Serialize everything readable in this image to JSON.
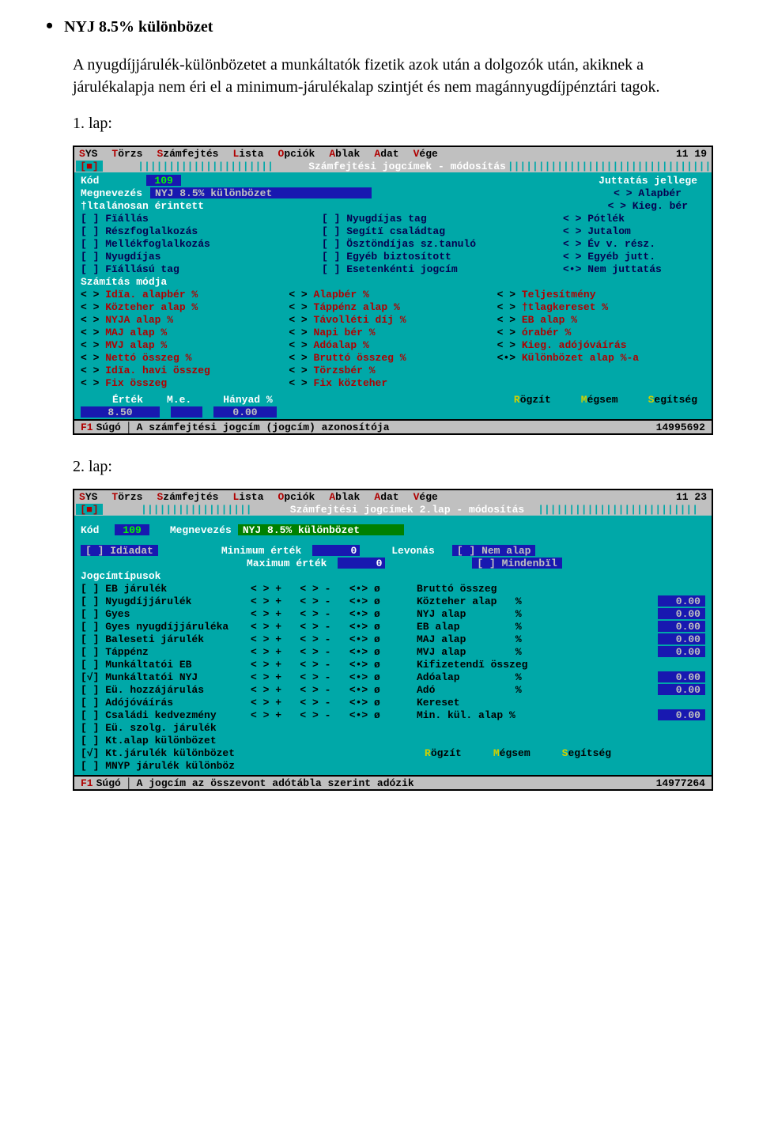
{
  "doc": {
    "heading": "NYJ 8.5% különbözet",
    "paragraph": "A nyugdíjjárulék-különbözetet a munkáltatók fizetik azok után a dolgozók után, akiknek a járulékalapja nem éri el a minimum-járulékalap szintjét és nem magánnyugdíjpénztári tagok.",
    "lap1": "1. lap:",
    "lap2": "2. lap:"
  },
  "win1": {
    "menu": [
      "SYS",
      "Törzs",
      "Számfejtés",
      "Lista",
      "Opciók",
      "Ablak",
      "Adat",
      "Vége"
    ],
    "time": "11 19",
    "title": "Számfejtési jogcímek - módosítás",
    "kod_lbl": "Kód",
    "kod_val": "109",
    "meg_lbl": "Megnevezés",
    "meg_val": "NYJ 8.5% különbözet",
    "jutt_hdr": "Juttatás jellege",
    "erintett_hdr": "†ltalánosan érintett",
    "erintett_col1": [
      "[ ] Fïállás",
      "[ ] Részfoglalkozás",
      "[ ] Mellékfoglalkozás",
      "[ ] Nyugdíjas",
      "[ ] Fïállású tag"
    ],
    "erintett_col2": [
      "[ ] Nyugdíjas tag",
      "[ ] Segítï családtag",
      "[ ] Ösztöndíjas sz.tanuló",
      "[ ] Egyéb biztosított",
      "[ ] Esetenkénti jogcím"
    ],
    "jutt_items": [
      "< > Alapbér",
      "< > Kieg. bér",
      "< > Pótlék",
      "< > Jutalom",
      "< > Év v. rész.",
      "< > Egyéb jutt.",
      "<•> Nem juttatás"
    ],
    "szmod_hdr": "Számítás módja",
    "szmod_col1": [
      "< > Idïa. alapbér %",
      "< > Közteher alap %",
      "< > NYJA alap %",
      "< > MAJ alap %",
      "< > MVJ alap %",
      "< > Nettó összeg %",
      "< > Idïa. havi összeg",
      "< > Fix összeg"
    ],
    "szmod_col2": [
      "< > Alapbér %",
      "< > Táppénz alap %",
      "< > Távolléti díj %",
      "< > Napi bér %",
      "< > Adóalap %",
      "< > Bruttó összeg %",
      "< > Törzsbér %",
      "< > Fix közteher"
    ],
    "szmod_col3": [
      "< > Teljesítmény",
      "< > †tlagkereset %",
      "< > EB alap %",
      "< > órabér %",
      "< > Kieg. adójóváírás",
      "<•> Különbözet alap %-a",
      "",
      ""
    ],
    "btmlbls": {
      "ertek": "Érték",
      "me": "M.e.",
      "hanyad": "Hányad %"
    },
    "ertek_val": "8.50",
    "hanyad_val": "0.00",
    "buttons": {
      "rogzit": "Rögzít",
      "megsem": "Mégsem",
      "segit": "Segítség"
    },
    "status": {
      "f1": "F1",
      "sugo": "Súgó",
      "txt": "A számfejtési jogcím (jogcím) azonosítója",
      "num": "14995692"
    }
  },
  "win2": {
    "menu": [
      "SYS",
      "Törzs",
      "Számfejtés",
      "Lista",
      "Opciók",
      "Ablak",
      "Adat",
      "Vége"
    ],
    "time": "11 23",
    "title": "Számfejtési jogcímek 2.lap - módosítás",
    "kod_lbl": "Kód",
    "kod_val": "109",
    "meg_lbl": "Megnevezés",
    "meg_val": "NYJ 8.5% különbözet",
    "idiadat": "[ ] Idïadat",
    "min_lbl": "Minimum érték",
    "min_val": "0",
    "max_lbl": "Maximum érték",
    "max_val": "0",
    "levonas": "Levonás",
    "nemalap": "[ ] Nem alap",
    "mindenbil": "[ ] Mindenbïl",
    "jog_hdr": "Jogcímtípusok",
    "rows": [
      {
        "l": "[ ] EB járulék",
        "o": "< > +   < > -   <•> ø",
        "r": "Bruttó összeg",
        "p": ""
      },
      {
        "l": "[ ] Nyugdíjjárulék",
        "o": "< > +   < > -   <•> ø",
        "r": "Közteher alap   %",
        "p": "0.00"
      },
      {
        "l": "[ ] Gyes",
        "o": "< > +   < > -   <•> ø",
        "r": "NYJ alap        %",
        "p": "0.00"
      },
      {
        "l": "[ ] Gyes nyugdíjjáruléka",
        "o": "< > +   < > -   <•> ø",
        "r": "EB alap         %",
        "p": "0.00"
      },
      {
        "l": "[ ] Baleseti járulék",
        "o": "< > +   < > -   <•> ø",
        "r": "MAJ alap        %",
        "p": "0.00"
      },
      {
        "l": "[ ] Táppénz",
        "o": "< > +   < > -   <•> ø",
        "r": "MVJ alap        %",
        "p": "0.00"
      },
      {
        "l": "[ ] Munkáltatói EB",
        "o": "< > +   < > -   <•> ø",
        "r": "Kifizetendï összeg",
        "p": ""
      },
      {
        "l": "[√] Munkáltatói NYJ",
        "o": "< > +   < > -   <•> ø",
        "r": "Adóalap         %",
        "p": "0.00"
      },
      {
        "l": "[ ] Eü. hozzájárulás",
        "o": "< > +   < > -   <•> ø",
        "r": "Adó             %",
        "p": "0.00"
      },
      {
        "l": "[ ] Adójóváírás",
        "o": "< > +   < > -   <•> ø",
        "r": "Kereset",
        "p": ""
      },
      {
        "l": "[ ] Családi kedvezmény",
        "o": "< > +   < > -   <•> ø",
        "r": "Min. kül. alap %",
        "p": "0.00"
      },
      {
        "l": "[ ] Eü. szolg. járulék",
        "o": "",
        "r": "",
        "p": ""
      },
      {
        "l": "[ ] Kt.alap különbözet",
        "o": "",
        "r": "",
        "p": ""
      },
      {
        "l": "[√] Kt.járulék különbözet",
        "o": "",
        "r": "__BTNROW__",
        "p": ""
      },
      {
        "l": "[ ] MNYP járulék különböz",
        "o": "",
        "r": "",
        "p": ""
      }
    ],
    "buttons": {
      "rogzit": "Rögzít",
      "megsem": "Mégsem",
      "segit": "Segítség"
    },
    "status": {
      "f1": "F1",
      "sugo": "Súgó",
      "txt": "A jogcím az összevont adótábla szerint adózik",
      "num": "14977264"
    }
  }
}
